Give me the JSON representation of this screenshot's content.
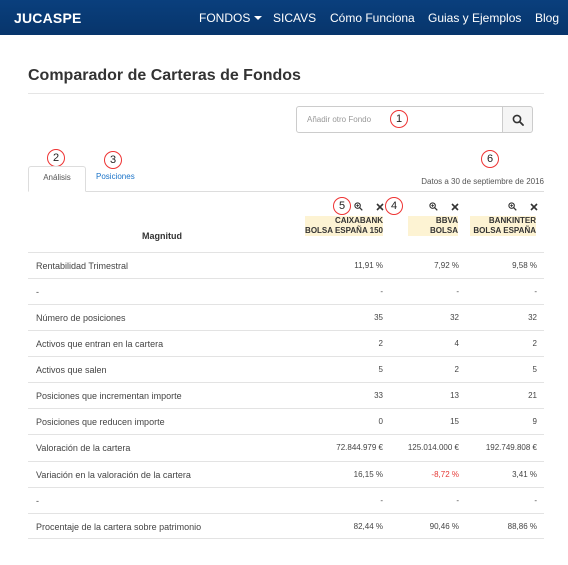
{
  "navbar": {
    "brand": "JUCASPE",
    "items": [
      "FONDOS",
      "SICAVS",
      "Cómo Funciona",
      "Guias y Ejemplos",
      "Blog"
    ]
  },
  "page": {
    "title": "Comparador de Carteras de Fondos"
  },
  "search": {
    "placeholder": "Añadir otro Fondo"
  },
  "tabs": {
    "analisis": "Análisis",
    "posiciones": "Posiciones"
  },
  "date_text": "Datos a 30 de septiembre de 2016",
  "badges": [
    "1",
    "2",
    "3",
    "4",
    "5",
    "6"
  ],
  "table": {
    "header": "Magnitud",
    "funds": [
      "CAIXABANK BOLSA ESPAÑA 150",
      "BBVA BOLSA",
      "BANKINTER BOLSA ESPAÑA"
    ],
    "rows": [
      {
        "label": "Rentabilidad Trimestral",
        "values": [
          "11,91 %",
          "7,92 %",
          "9,58 %"
        ]
      },
      {
        "label": "-",
        "values": [
          "-",
          "-",
          "-"
        ]
      },
      {
        "label": "Número de posiciones",
        "values": [
          "35",
          "32",
          "32"
        ]
      },
      {
        "label": "Activos que entran en la cartera",
        "values": [
          "2",
          "4",
          "2"
        ]
      },
      {
        "label": "Activos que salen",
        "values": [
          "5",
          "2",
          "5"
        ]
      },
      {
        "label": "Posiciones que incrementan importe",
        "values": [
          "33",
          "13",
          "21"
        ]
      },
      {
        "label": "Posiciones que reducen importe",
        "values": [
          "0",
          "15",
          "9"
        ]
      },
      {
        "label": "Valoración de la cartera",
        "values": [
          "72.844.979 €",
          "125.014.000 €",
          "192.749.808 €"
        ]
      },
      {
        "label": "Variación en la valoración de la cartera",
        "values": [
          "16,15 %",
          "-8,72 %",
          "3,41 %"
        ]
      },
      {
        "label": "-",
        "values": [
          "-",
          "-",
          "-"
        ]
      },
      {
        "label": "Procentaje de la cartera sobre patrimonio",
        "values": [
          "82,44 %",
          "90,46 %",
          "88,86 %"
        ]
      }
    ]
  },
  "colors": {
    "navbar": "#07356b",
    "link": "#1a73c8",
    "negative": "#e53935",
    "badge": "#e33333"
  },
  "icons": [
    "search-icon",
    "zoom-in-icon",
    "close-icon",
    "caret-down-icon"
  ]
}
